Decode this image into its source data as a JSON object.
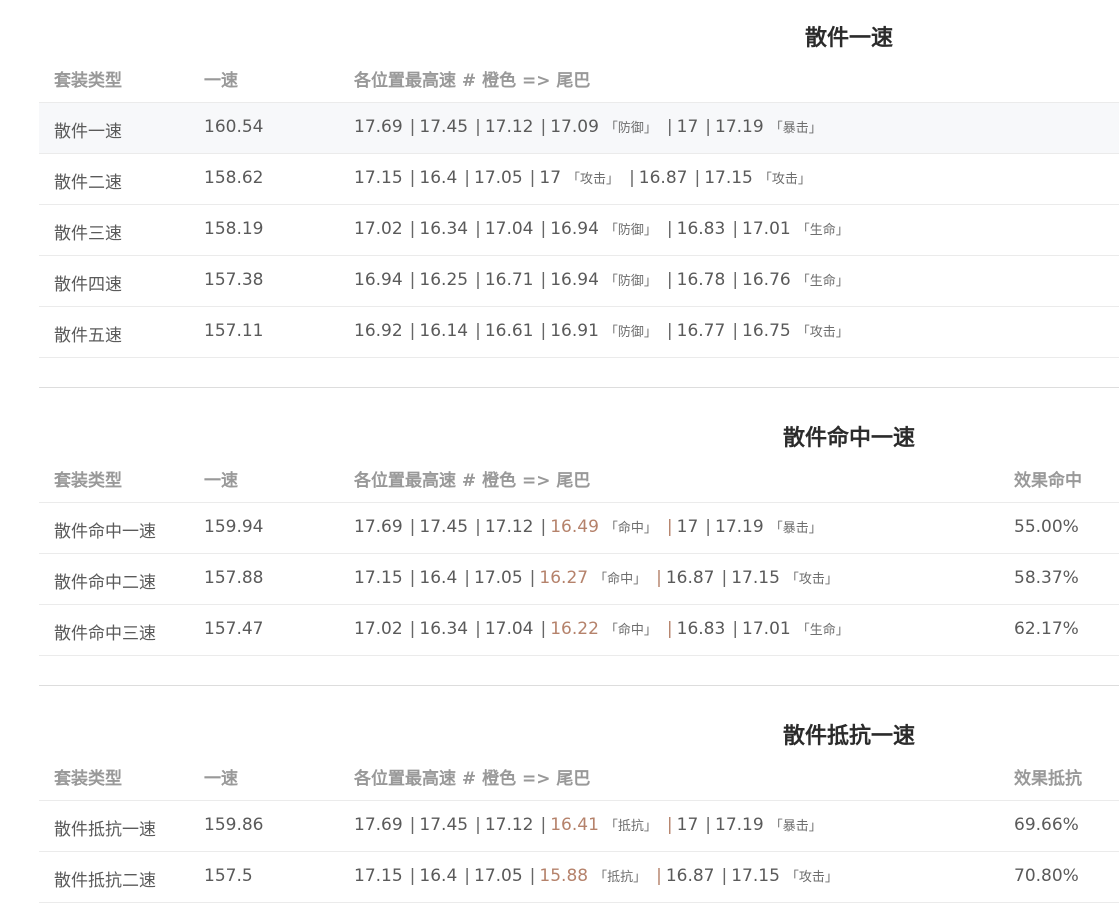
{
  "sections": [
    {
      "title": "散件一速",
      "headers": [
        "套装类型",
        "一速",
        "各位置最高速 # 橙色 => 尾巴"
      ],
      "rows": [
        {
          "type": "散件一速",
          "speed": "160.54",
          "s": [
            "17.69",
            "17.45",
            "17.12",
            "17.09",
            "17",
            "17.19"
          ],
          "t3": "「防御」",
          "t5": "「暴击」"
        },
        {
          "type": "散件二速",
          "speed": "158.62",
          "s": [
            "17.15",
            "16.4",
            "17.05",
            "17",
            "16.87",
            "17.15"
          ],
          "t3": "「攻击」",
          "t5": "「攻击」"
        },
        {
          "type": "散件三速",
          "speed": "158.19",
          "s": [
            "17.02",
            "16.34",
            "17.04",
            "16.94",
            "16.83",
            "17.01"
          ],
          "t3": "「防御」",
          "t5": "「生命」"
        },
        {
          "type": "散件四速",
          "speed": "157.38",
          "s": [
            "16.94",
            "16.25",
            "16.71",
            "16.94",
            "16.78",
            "16.76"
          ],
          "t3": "「防御」",
          "t5": "「生命」"
        },
        {
          "type": "散件五速",
          "speed": "157.11",
          "s": [
            "16.92",
            "16.14",
            "16.61",
            "16.91",
            "16.77",
            "16.75"
          ],
          "t3": "「防御」",
          "t5": "「攻击」"
        }
      ]
    },
    {
      "title": "散件命中一速",
      "headers": [
        "套装类型",
        "一速",
        "各位置最高速 # 橙色 => 尾巴",
        "效果命中"
      ],
      "rows": [
        {
          "type": "散件命中一速",
          "speed": "159.94",
          "s": [
            "17.69",
            "17.45",
            "17.12",
            "16.49",
            "17",
            "17.19"
          ],
          "t3": "「命中」",
          "t5": "「暴击」",
          "extra": "55.00%"
        },
        {
          "type": "散件命中二速",
          "speed": "157.88",
          "s": [
            "17.15",
            "16.4",
            "17.05",
            "16.27",
            "16.87",
            "17.15"
          ],
          "t3": "「命中」",
          "t5": "「攻击」",
          "extra": "58.37%"
        },
        {
          "type": "散件命中三速",
          "speed": "157.47",
          "s": [
            "17.02",
            "16.34",
            "17.04",
            "16.22",
            "16.83",
            "17.01"
          ],
          "t3": "「命中」",
          "t5": "「生命」",
          "extra": "62.17%"
        }
      ]
    },
    {
      "title": "散件抵抗一速",
      "headers": [
        "套装类型",
        "一速",
        "各位置最高速 # 橙色 => 尾巴",
        "效果抵抗"
      ],
      "rows": [
        {
          "type": "散件抵抗一速",
          "speed": "159.86",
          "s": [
            "17.69",
            "17.45",
            "17.12",
            "16.41",
            "17",
            "17.19"
          ],
          "t3": "「抵抗」",
          "t5": "「暴击」",
          "extra": "69.66%"
        },
        {
          "type": "散件抵抗二速",
          "speed": "157.5",
          "s": [
            "17.15",
            "16.4",
            "17.05",
            "15.88",
            "16.87",
            "17.15"
          ],
          "t3": "「抵抗」",
          "t5": "「攻击」",
          "extra": "70.80%"
        }
      ]
    }
  ],
  "colors": {
    "accent_tail": "#b5826b",
    "header_text": "#999999",
    "row_highlight": "#f7f8fa"
  }
}
